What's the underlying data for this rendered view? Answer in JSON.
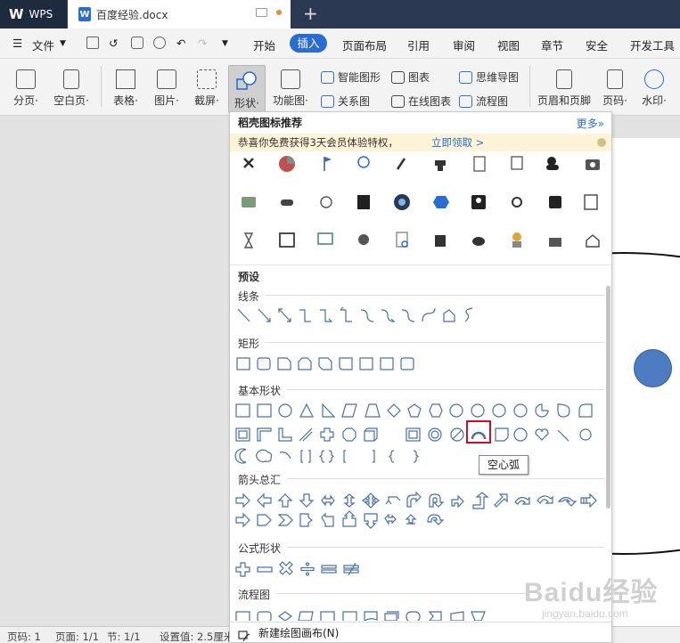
{
  "titlebar": {
    "app_name": "WPS",
    "doc_name": "百度经验.docx",
    "new_tab": "+"
  },
  "menubar": {
    "file": "文件",
    "tabs": [
      "开始",
      "插入",
      "页面布局",
      "引用",
      "审阅",
      "视图",
      "章节",
      "安全",
      "开发工具"
    ],
    "active_tab": "插入"
  },
  "ribbon": {
    "page_break": "分页·",
    "blank_page": "空白页·",
    "table": "表格·",
    "picture": "图片·",
    "screenshot": "截屏·",
    "shape": "形状·",
    "function_chart": "功能图·",
    "smart_shape": "智能图形",
    "chart": "图表",
    "mind_map": "思维导图",
    "relation_chart": "关系图",
    "online_chart": "在线图表",
    "flow_chart": "流程图",
    "header_footer": "页眉和页脚",
    "page_number": "页码·",
    "watermark": "水印·"
  },
  "panel": {
    "title": "稻壳图标推荐",
    "more": "更多»",
    "promo_text": "恭喜你免费获得3天会员体验特权，",
    "promo_link": "立即领取 >",
    "preset": "预设",
    "lines": "线条",
    "rect": "矩形",
    "basic": "基本形状",
    "arrows": "箭头总汇",
    "formula": "公式形状",
    "flow": "流程图",
    "footer": "新建绘图画布(N)",
    "tooltip": "空心弧"
  },
  "status": {
    "page_code": "页码: 1",
    "page": "页面: 1/1",
    "section": "节: 1/1",
    "setting": "设置值: 2.5厘米"
  },
  "watermark": {
    "text": "Baidu经验",
    "url": "jingyan.baidu.com"
  },
  "colors": {
    "accent": "#2b6cd1",
    "titlebar": "#2b3a52",
    "selected": "#c8102e",
    "promo_bg": "#fdf3d7",
    "shape_blue": "#4e7cc2"
  }
}
